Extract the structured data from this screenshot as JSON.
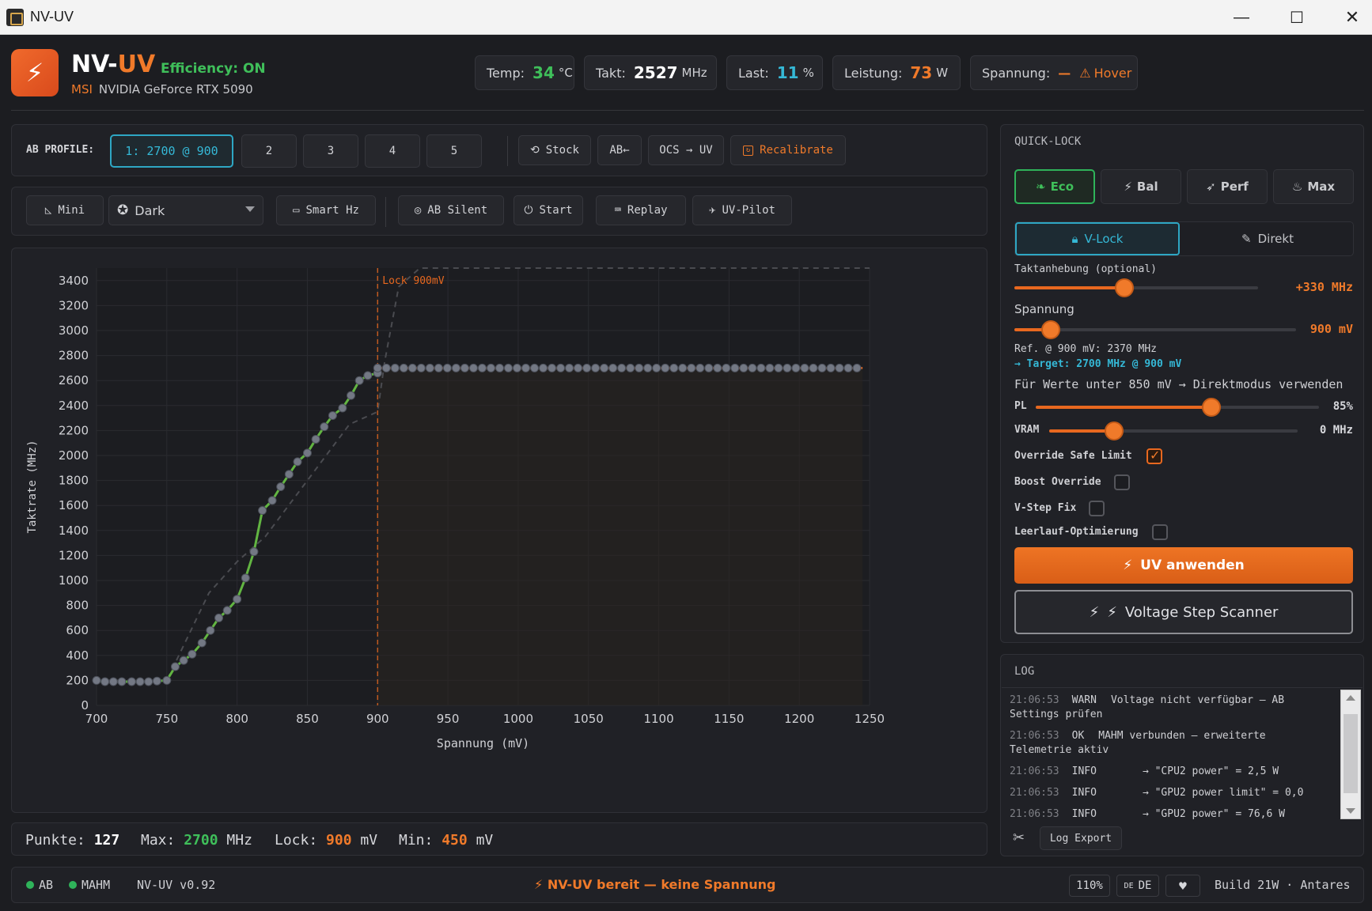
{
  "window": {
    "title": "NV-UV",
    "minimize": "—",
    "maximize": "☐",
    "close": "✕"
  },
  "header": {
    "brand_a": "NV-",
    "brand_b": "UV",
    "efficiency": "Efficiency: ON",
    "vendor": "MSI",
    "gpu": "NVIDIA GeForce RTX 5090",
    "stats": {
      "temp": {
        "label": "Temp:",
        "value": "34",
        "unit": "°C"
      },
      "clock": {
        "label": "Takt:",
        "value": "2527",
        "unit": "MHz"
      },
      "load": {
        "label": "Last:",
        "value": "11",
        "unit": "%"
      },
      "power": {
        "label": "Leistung:",
        "value": "73",
        "unit": "W"
      },
      "voltage": {
        "label": "Spannung:",
        "value": "—",
        "hover": "Hover"
      }
    }
  },
  "profiles": {
    "label": "AB PROFILE:",
    "items": [
      "1: 2700 @ 900",
      "2",
      "3",
      "4",
      "5"
    ],
    "stock": "Stock",
    "ab_back": "AB←",
    "ocs_uv": "OCS → UV",
    "recalibrate": "Recalibrate"
  },
  "toolbar": {
    "mini": "Mini",
    "theme": "Dark",
    "smart_hz": "Smart Hz",
    "ab_silent": "AB Silent",
    "start": "Start",
    "replay": "Replay",
    "uv_pilot": "UV-Pilot"
  },
  "chart_data": {
    "type": "line",
    "xlabel": "Spannung (mV)",
    "ylabel": "Taktrate (MHz)",
    "xlim": [
      700,
      1250
    ],
    "ylim": [
      0,
      3500
    ],
    "xticks": [
      700,
      750,
      800,
      850,
      900,
      950,
      1000,
      1050,
      1100,
      1150,
      1200,
      1250
    ],
    "yticks": [
      0,
      200,
      400,
      600,
      800,
      1000,
      1200,
      1400,
      1600,
      1800,
      2000,
      2200,
      2400,
      2600,
      2800,
      3000,
      3200,
      3400
    ],
    "lock_label": "Lock 900mV",
    "lock_x": 900,
    "grid": true,
    "series": [
      {
        "role": "curve",
        "color": "#62b542",
        "x": [
          700,
          706,
          712,
          718,
          725,
          731,
          737,
          743,
          750,
          756,
          762,
          768,
          775,
          781,
          787,
          793,
          800,
          806,
          812,
          818,
          825,
          831,
          837,
          843,
          850,
          856,
          862,
          868,
          875,
          881,
          887,
          893,
          900
        ],
        "y": [
          200,
          190,
          190,
          190,
          190,
          190,
          190,
          195,
          200,
          310,
          360,
          410,
          500,
          600,
          700,
          760,
          850,
          1020,
          1230,
          1560,
          1640,
          1750,
          1850,
          1950,
          2020,
          2130,
          2230,
          2320,
          2380,
          2480,
          2600,
          2640,
          2660
        ]
      },
      {
        "role": "flat",
        "color": "#e8681f",
        "from_x": 900,
        "to_x": 1245,
        "y": 2700,
        "step": 6.2
      },
      {
        "role": "reference",
        "color": "#4a4b50",
        "x": [
          700,
          750,
          780,
          800,
          820,
          840,
          860,
          880,
          900,
          905,
          915,
          930,
          950,
          1250
        ],
        "y": [
          200,
          200,
          900,
          1150,
          1350,
          1650,
          1950,
          2250,
          2350,
          2750,
          3350,
          3500,
          3500,
          3500
        ]
      }
    ]
  },
  "stats_bar": {
    "points_label": "Punkte:",
    "points": "127",
    "max_label": "Max:",
    "max": "2700",
    "max_unit": "MHz",
    "lock_label": "Lock:",
    "lock": "900",
    "lock_unit": "mV",
    "min_label": "Min:",
    "min": "450",
    "min_unit": "mV"
  },
  "quicklock": {
    "title": "QUICK-LOCK",
    "presets": [
      "Eco",
      "Bal",
      "Perf",
      "Max"
    ],
    "modes": [
      "V-Lock",
      "Direkt"
    ],
    "clock_boost_label": "Taktanhebung (optional)",
    "clock_boost_value": "+330 MHz",
    "clock_boost_level": 0.45,
    "voltage_label": "Spannung",
    "voltage_value": "900 mV",
    "voltage_level": 0.13,
    "ref_text": "Ref. @ 900 mV: 2370 MHz",
    "target_text": "→ Target: 2700 MHz @ 900 mV",
    "hint_text": "Für Werte unter 850 mV → Direktmodus verwenden",
    "pl_label": "PL",
    "pl_value": "85%",
    "pl_level": 0.62,
    "vram_label": "VRAM",
    "vram_value": "0 MHz",
    "vram_level": 0.26,
    "checks": [
      {
        "label": "Override Safe Limit",
        "checked": true
      },
      {
        "label": "Boost Override",
        "checked": false
      },
      {
        "label": "V-Step Fix",
        "checked": false
      },
      {
        "label": "Leerlauf-Optimierung",
        "checked": false
      }
    ],
    "apply": "UV anwenden",
    "scanner": "Voltage Step Scanner"
  },
  "log": {
    "title": "LOG",
    "entries": [
      {
        "time": "21:06:53",
        "level": "WARN",
        "msg": "Voltage nicht verfügbar — AB Settings prüfen"
      },
      {
        "time": "21:06:53",
        "level": "OK",
        "msg": "MAHM verbunden — erweiterte Telemetrie aktiv"
      },
      {
        "time": "21:06:53",
        "level": "INFO",
        "msg": "→ \"CPU2 power\" = 2,5 W"
      },
      {
        "time": "21:06:53",
        "level": "INFO",
        "msg": "→ \"GPU2 power limit\" = 0,0"
      },
      {
        "time": "21:06:53",
        "level": "INFO",
        "msg": "→ \"GPU2 power\" = 76,6 W"
      }
    ],
    "export": "Log Export"
  },
  "statusbar": {
    "ab": "AB",
    "mahm": "MAHM",
    "version": "NV-UV v0.92",
    "message": "NV-UV bereit — keine Spannung",
    "zoom": "110%",
    "lang_flag": "DE",
    "lang": "DE",
    "build": "Build 21W · Antares"
  }
}
